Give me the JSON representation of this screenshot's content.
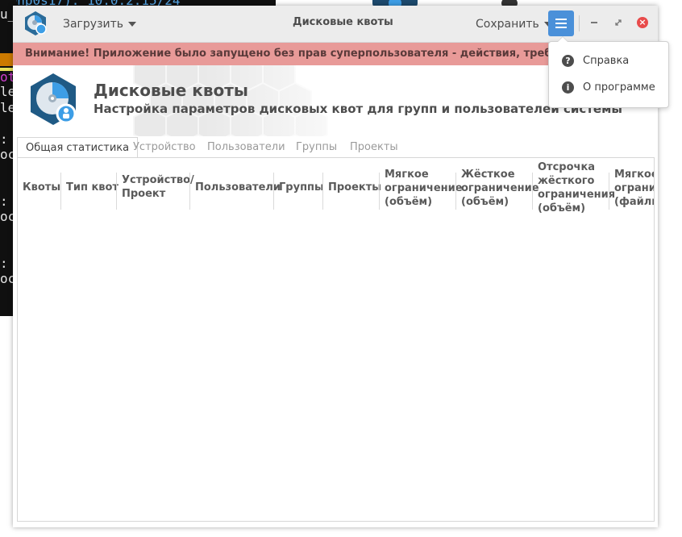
{
  "background": {
    "terminal_top": "(enp0s17): 10.0.2.15/24",
    "terminal_line2": "u_",
    "terminal_lines": [
      "ot",
      "le",
      "le",
      ":",
      "oc",
      ":",
      "oc",
      ":",
      "oc"
    ]
  },
  "titlebar": {
    "load_label": "Загрузить",
    "title": "Дисковые квоты",
    "save_label": "Сохранить"
  },
  "warning": {
    "text": "Внимание! Приложение было запущено без прав суперпользователя - действия, требующие их наличия, недоступны"
  },
  "header": {
    "title": "Дисковые квоты",
    "subtitle": "Настройка параметров дисковых квот для групп и пользователей системы"
  },
  "tabs": [
    {
      "label": "Общая статистика",
      "active": true
    },
    {
      "label": "Устройство",
      "active": false
    },
    {
      "label": "Пользователи",
      "active": false
    },
    {
      "label": "Группы",
      "active": false
    },
    {
      "label": "Проекты",
      "active": false
    }
  ],
  "table": {
    "columns": [
      "Квоты",
      "Тип квот",
      "Устройство/\nПроект",
      "Пользователи",
      "Группы",
      "Проекты",
      "Мягкое\nограничение\n(объём)",
      "Жёсткое\nограничение\n(объём)",
      "Отсрочка\nжёсткого\nограничения\n(объём)",
      "Мягкое\nограничение\n(файлы)"
    ],
    "rows": []
  },
  "menu_popup": {
    "items": [
      {
        "label": "Справка",
        "icon": "help-icon"
      },
      {
        "label": "О программе",
        "icon": "info-icon"
      }
    ]
  },
  "colors": {
    "accent": "#4a90d9",
    "warning_bg": "#e89a98",
    "close": "#e84b4b"
  }
}
